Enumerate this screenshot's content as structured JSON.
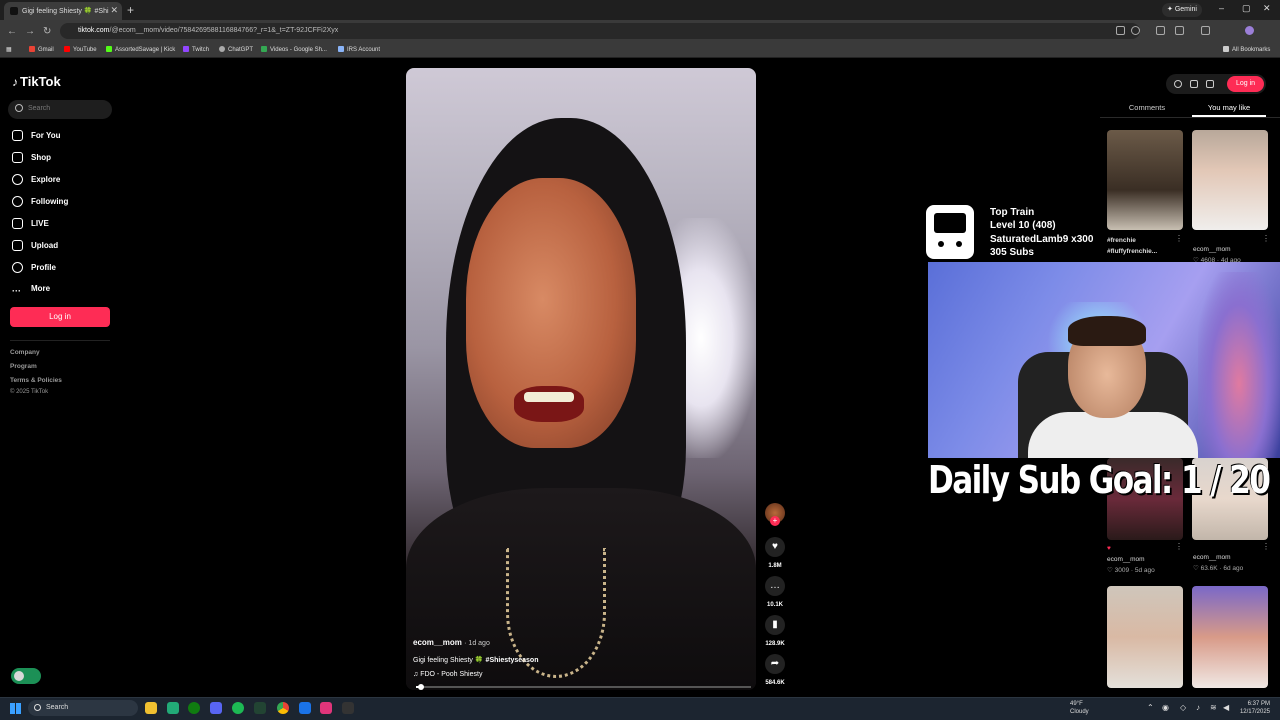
{
  "browser": {
    "tab_title": "Gigi feeling Shiesty 🍀 #Shi",
    "gemini_label": "Gemini",
    "url_domain": "tiktok.com",
    "url_path": "/@ecom__mom/video/7584269588116884766?_r=1&_t=ZT-92JCFFi2Xyx",
    "bookmarks": [
      "Gmail",
      "YouTube",
      "AssortedSavage | Kick",
      "Twitch",
      "ChatGPT",
      "Videos - Google Sh...",
      "IRS Account"
    ],
    "all_bookmarks": "All Bookmarks"
  },
  "sidebar": {
    "logo": "TikTok",
    "search_placeholder": "Search",
    "items": [
      {
        "label": "For You",
        "icon": "home-icon"
      },
      {
        "label": "Shop",
        "icon": "shop-icon"
      },
      {
        "label": "Explore",
        "icon": "compass-icon"
      },
      {
        "label": "Following",
        "icon": "following-icon"
      },
      {
        "label": "LIVE",
        "icon": "live-icon"
      },
      {
        "label": "Upload",
        "icon": "upload-icon"
      },
      {
        "label": "Profile",
        "icon": "profile-icon"
      },
      {
        "label": "More",
        "icon": "more-icon"
      }
    ],
    "login_label": "Log in",
    "footer": [
      "Company",
      "Program",
      "Terms & Policies"
    ],
    "copyright": "© 2025 TikTok"
  },
  "video": {
    "username": "ecom__mom",
    "age": "· 1d ago",
    "caption": "Gigi feeling Shiesty 🍀",
    "hashtag": "#Shiestyseason",
    "music": "♫ FDO - Pooh Shiesty",
    "progress": 0.015
  },
  "actions": {
    "likes": "1.8M",
    "comments": "10.1K",
    "saves": "128.9K",
    "shares": "584.6K"
  },
  "right_panel": {
    "login_label": "Log in",
    "tab_comments": "Comments",
    "tab_like": "You may like",
    "thumbs": [
      {
        "tags": "#frenchie",
        "tags2": "#fluffyfrenchie..."
      },
      {
        "user": "ecom__mom",
        "stats": "♡ 4608 · 4d ago"
      },
      {
        "user": "ecom__mom",
        "stats": "♡ 3009 · 5d ago"
      },
      {
        "user": "ecom__mom",
        "stats": "♡ 63.6K · 6d ago"
      }
    ]
  },
  "stream_overlay": {
    "train_title": "Top Train",
    "train_level": "Level 10  (408)",
    "train_user": "SaturatedLamb9 x300",
    "train_subs": "305 Subs",
    "sub_goal": "Daily Sub Goal: 1 / 20"
  },
  "taskbar": {
    "search_label": "Search",
    "weather_temp": "49°F",
    "weather_desc": "Cloudy",
    "time": "6:37 PM",
    "date": "12/17/2025"
  }
}
